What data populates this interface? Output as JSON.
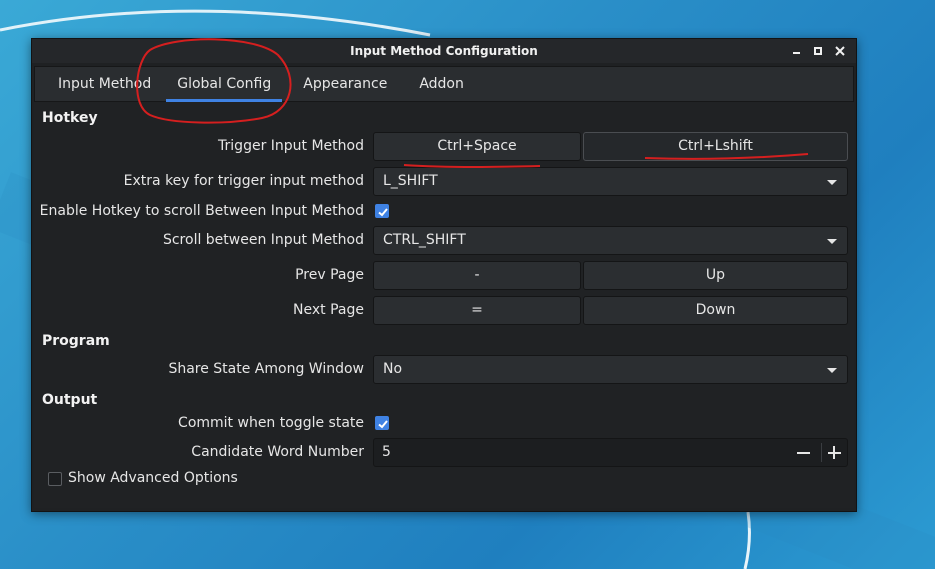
{
  "window": {
    "title": "Input Method Configuration"
  },
  "tabs": [
    {
      "label": "Input Method"
    },
    {
      "label": "Global Config"
    },
    {
      "label": "Appearance"
    },
    {
      "label": "Addon"
    }
  ],
  "hotkey": {
    "section": "Hotkey",
    "trigger_label": "Trigger Input Method",
    "trigger_key1": "Ctrl+Space",
    "trigger_key2": "Ctrl+Lshift",
    "extra_label": "Extra key for trigger input method",
    "extra_value": "L_SHIFT",
    "enable_scroll_label": "Enable Hotkey to scroll Between Input Method",
    "enable_scroll_checked": true,
    "scroll_label": "Scroll between Input Method",
    "scroll_value": "CTRL_SHIFT",
    "prev_label": "Prev Page",
    "prev_key1": "-",
    "prev_key2": "Up",
    "next_label": "Next Page",
    "next_key1": "=",
    "next_key2": "Down"
  },
  "program": {
    "section": "Program",
    "share_label": "Share State Among Window",
    "share_value": "No"
  },
  "output": {
    "section": "Output",
    "commit_label": "Commit when toggle state",
    "commit_checked": true,
    "candidate_label": "Candidate Word Number",
    "candidate_value": "5"
  },
  "advanced": {
    "label": "Show Advanced Options",
    "checked": false
  },
  "icons": {
    "minimize": "minimize-icon",
    "maximize": "maximize-icon",
    "close": "close-icon",
    "dropdown": "chevron-down-icon",
    "check": "check-icon",
    "decrement": "minus-icon",
    "increment": "plus-icon"
  },
  "colors": {
    "accent": "#3f82e3",
    "annotation": "#d51f1f"
  }
}
